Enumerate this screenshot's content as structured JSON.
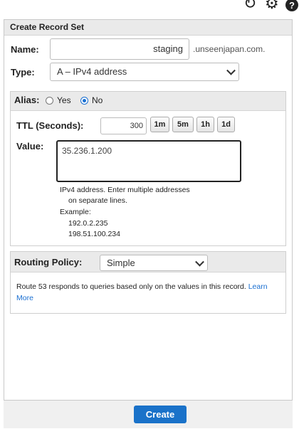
{
  "panel": {
    "title": "Create Record Set"
  },
  "name": {
    "label": "Name:",
    "value": "staging",
    "suffix": ".unseenjapan.com."
  },
  "type": {
    "label": "Type:",
    "selected": "A – IPv4 address"
  },
  "alias": {
    "label": "Alias:",
    "yes": "Yes",
    "no": "No",
    "selected": "No"
  },
  "ttl": {
    "label": "TTL (Seconds):",
    "value": "300",
    "buttons": [
      "1m",
      "5m",
      "1h",
      "1d"
    ]
  },
  "value": {
    "label": "Value:",
    "text": "35.236.1.200",
    "help_line1": "IPv4 address. Enter multiple addresses",
    "help_line2": "on separate lines.",
    "example_label": "Example:",
    "example1": "192.0.2.235",
    "example2": "198.51.100.234"
  },
  "routing": {
    "label": "Routing Policy:",
    "selected": "Simple",
    "description": "Route 53 responds to queries based only on the values in this record.",
    "learn_more": "Learn More"
  },
  "footer": {
    "create_label": "Create"
  },
  "icons": [
    "refresh-icon",
    "gear-icon",
    "help-icon"
  ]
}
